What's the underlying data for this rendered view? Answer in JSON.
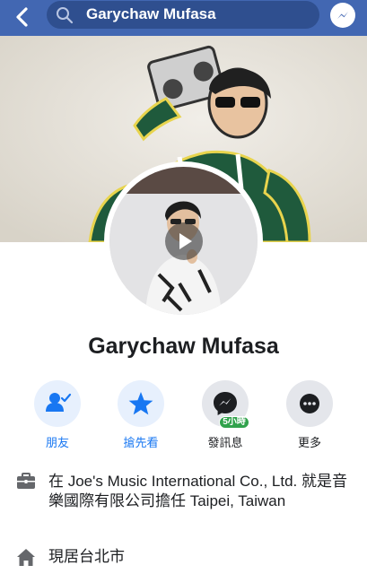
{
  "search": {
    "query": "Garychaw Mufasa"
  },
  "profile": {
    "name": "Garychaw Mufasa"
  },
  "actions": {
    "friends": "朋友",
    "follow": "搶先看",
    "message": "發訊息",
    "message_badge": "5小時",
    "more": "更多"
  },
  "info": {
    "work": "在 Joe's Music International Co., Ltd. 就是音樂國際有限公司擔任 Taipei, Taiwan",
    "lives": "現居台北市"
  },
  "colors": {
    "header": "#4267b2",
    "accent": "#1877f2",
    "badge": "#31a24c"
  },
  "icons": {
    "back": "chevron-left-icon",
    "search": "search-icon",
    "messenger": "messenger-icon",
    "friends": "friend-check-icon",
    "follow": "star-icon",
    "message": "messenger-icon",
    "more": "more-dots-icon",
    "work": "briefcase-icon",
    "lives": "house-icon"
  }
}
